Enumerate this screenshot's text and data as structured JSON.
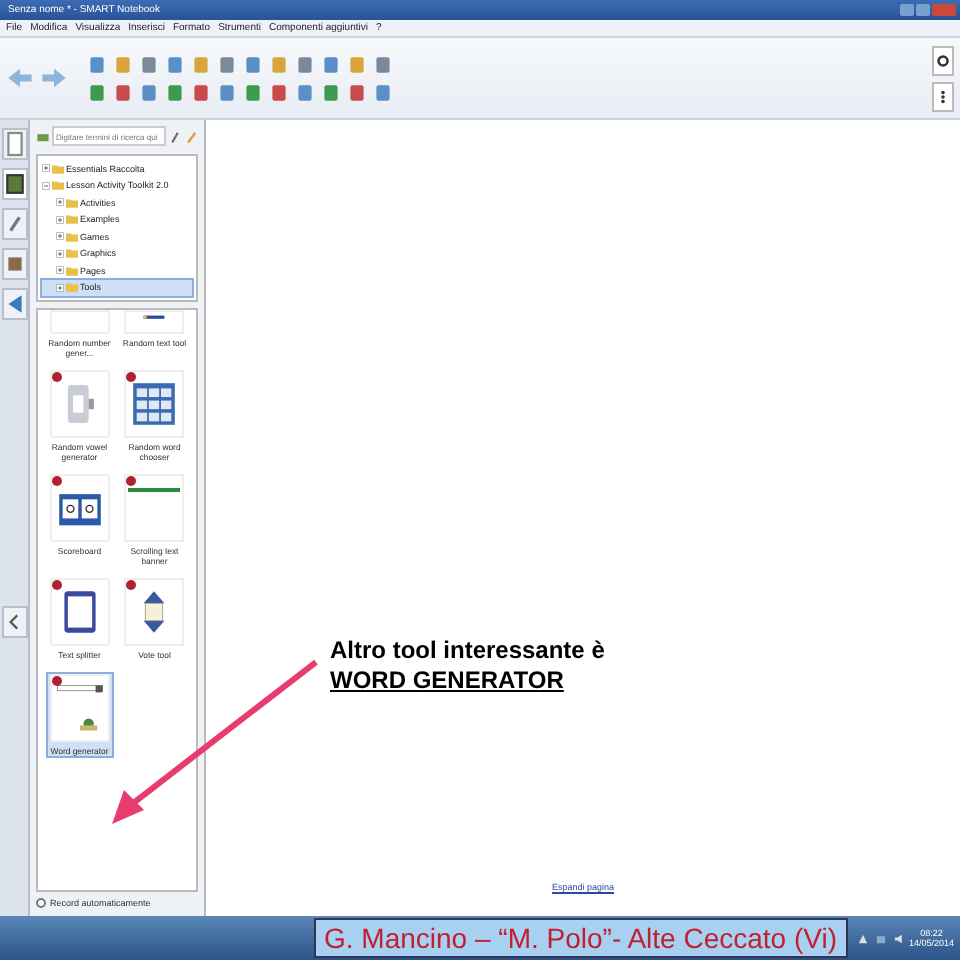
{
  "window": {
    "title": "Senza nome * - SMART Notebook"
  },
  "menu": [
    "File",
    "Modifica",
    "Visualizza",
    "Inserisci",
    "Formato",
    "Strumenti",
    "Componenti aggiuntivi",
    "?"
  ],
  "gallery_search": {
    "placeholder": "Digitare termini di ricerca qui"
  },
  "tree": [
    {
      "label": "Essentials Raccolta",
      "expanded": false,
      "selected": false
    },
    {
      "label": "Lesson Activity Toolkit 2.0",
      "expanded": true,
      "selected": false,
      "children": [
        {
          "label": "Activities",
          "expanded": false,
          "selected": false
        },
        {
          "label": "Examples",
          "expanded": false,
          "selected": false
        },
        {
          "label": "Games",
          "expanded": false,
          "selected": false
        },
        {
          "label": "Graphics",
          "expanded": false,
          "selected": false
        },
        {
          "label": "Pages",
          "expanded": false,
          "selected": false
        },
        {
          "label": "Tools",
          "expanded": false,
          "selected": true
        }
      ]
    }
  ],
  "gallery": [
    {
      "label": "Random number gener...",
      "kind": "blank",
      "flash": false,
      "selected": false
    },
    {
      "label": "Random text tool",
      "kind": "bar",
      "flash": false,
      "selected": false
    },
    {
      "label": "Random vowel generator",
      "kind": "vowel",
      "flash": true,
      "selected": false
    },
    {
      "label": "Random word chooser",
      "kind": "grid",
      "flash": true,
      "selected": false
    },
    {
      "label": "Scoreboard",
      "kind": "score",
      "flash": true,
      "selected": false
    },
    {
      "label": "Scrolling text banner",
      "kind": "banner",
      "flash": true,
      "selected": false
    },
    {
      "label": "Text splitter",
      "kind": "tablet",
      "flash": true,
      "selected": false
    },
    {
      "label": "Vote tool",
      "kind": "vote",
      "flash": true,
      "selected": false
    },
    {
      "label": "Word generator",
      "kind": "word",
      "flash": true,
      "selected": true
    }
  ],
  "auto_hide": {
    "label": "Record automaticamente",
    "checked": false
  },
  "canvas": {
    "annotation": [
      "Altro tool interessante è",
      "WORD GENERATOR"
    ],
    "expand_link": "Espandi pagina"
  },
  "taskbar": {
    "caption": "G. Mancino – “M. Polo”- Alte Ceccato (Vi)",
    "time": "08:22",
    "date": "14/05/2014"
  }
}
